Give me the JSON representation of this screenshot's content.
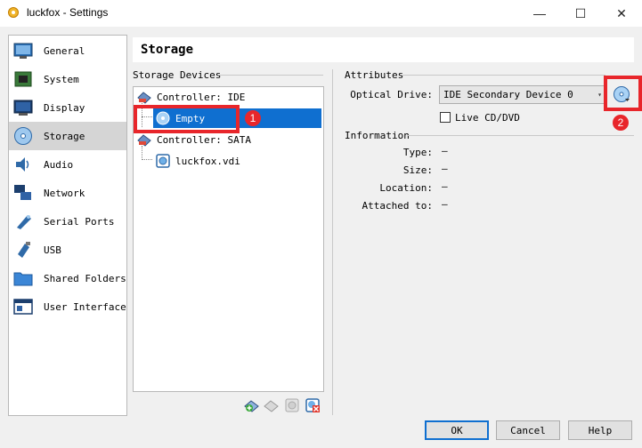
{
  "window": {
    "title": "luckfox - Settings",
    "app_icon": "virtualbox-gear-icon",
    "controls": {
      "minimize": "—",
      "maximize": "☐",
      "close": "✕"
    }
  },
  "sidebar": {
    "items": [
      {
        "label": "General",
        "icon": "general-icon",
        "selected": false
      },
      {
        "label": "System",
        "icon": "system-chip-icon",
        "selected": false
      },
      {
        "label": "Display",
        "icon": "display-monitor-icon",
        "selected": false
      },
      {
        "label": "Storage",
        "icon": "storage-disc-icon",
        "selected": true
      },
      {
        "label": "Audio",
        "icon": "audio-speaker-icon",
        "selected": false
      },
      {
        "label": "Network",
        "icon": "network-icon",
        "selected": false
      },
      {
        "label": "Serial Ports",
        "icon": "serial-port-icon",
        "selected": false
      },
      {
        "label": "USB",
        "icon": "usb-icon",
        "selected": false
      },
      {
        "label": "Shared Folders",
        "icon": "shared-folder-icon",
        "selected": false
      },
      {
        "label": "User Interface",
        "icon": "user-interface-icon",
        "selected": false
      }
    ]
  },
  "page": {
    "title": "Storage"
  },
  "storage_devices": {
    "heading": "Storage Devices",
    "tree": [
      {
        "label": "Controller: IDE",
        "type": "controller"
      },
      {
        "label": "Empty",
        "type": "optical",
        "selected": true
      },
      {
        "label": "Controller: SATA",
        "type": "controller"
      },
      {
        "label": "luckfox.vdi",
        "type": "disk"
      }
    ],
    "toolbar": [
      "add-attachment-icon",
      "remove-attachment-icon",
      "add-controller-icon",
      "remove-controller-icon"
    ]
  },
  "attributes": {
    "heading": "Attributes",
    "optical_drive_label": "Optical Drive:",
    "optical_drive_value": "IDE Secondary Device 0",
    "live_cd_label": "Live CD/DVD",
    "live_cd_checked": false
  },
  "information": {
    "heading": "Information",
    "rows": [
      {
        "label": "Type:",
        "value": "—"
      },
      {
        "label": "Size:",
        "value": "—"
      },
      {
        "label": "Location:",
        "value": "—"
      },
      {
        "label": "Attached to:",
        "value": "—"
      }
    ]
  },
  "annotations": {
    "marker_1": "1",
    "marker_2": "2",
    "color": "#e8262b"
  },
  "buttons": {
    "ok": "OK",
    "cancel": "Cancel",
    "help": "Help"
  },
  "colors": {
    "selection": "#0f6fd0",
    "background": "#f0f0f0"
  }
}
